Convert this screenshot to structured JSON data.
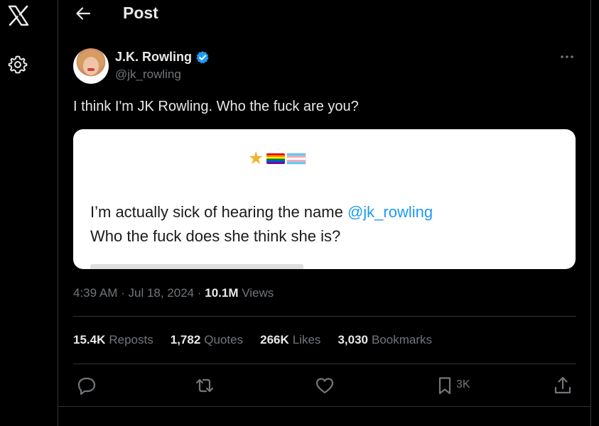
{
  "header": {
    "title": "Post"
  },
  "author": {
    "name": "J.K. Rowling",
    "handle": "@jk_rowling"
  },
  "tweet": {
    "text": "I think I'm JK Rowling. Who the fuck are you?"
  },
  "quoted": {
    "line1_prefix": "I’m actually sick of hearing the name ",
    "mention": "@jk_rowling",
    "line2": "Who the fuck does she think she is?"
  },
  "meta": {
    "time": "4:39 AM",
    "sep1": " · ",
    "date": "Jul 18, 2024",
    "sep2": " · ",
    "views_count": "10.1M",
    "views_label": "Views"
  },
  "stats": [
    {
      "count": "15.4K",
      "label": "Reposts"
    },
    {
      "count": "1,782",
      "label": "Quotes"
    },
    {
      "count": "266K",
      "label": "Likes"
    },
    {
      "count": "3,030",
      "label": "Bookmarks"
    }
  ],
  "actions": {
    "bookmark_count": "3K"
  },
  "icons": [
    "x-logo-icon",
    "gear-icon",
    "back-arrow-icon",
    "verified-icon",
    "more-icon",
    "reply-icon",
    "repost-icon",
    "like-icon",
    "bookmark-icon",
    "share-icon"
  ],
  "colors": {
    "background": "#000000",
    "text": "#e7e9ea",
    "muted": "#71767b",
    "accent": "#1d9bf0",
    "divider": "#2f3336"
  }
}
